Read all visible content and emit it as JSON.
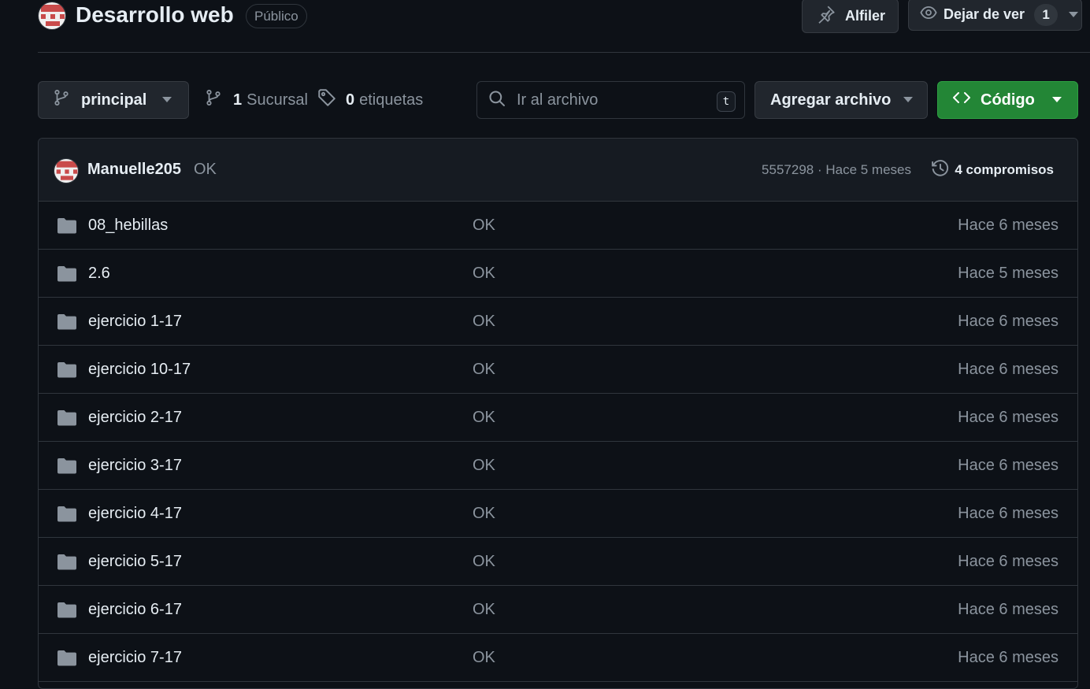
{
  "repo": {
    "title": "Desarrollo web",
    "visibility": "Público",
    "pin_label": "Alfiler",
    "watch_label": "Dejar de ver",
    "watch_count": "1"
  },
  "toolbar": {
    "branch": "principal",
    "branch_count": "1",
    "branch_label": "Sucursal",
    "tag_count": "0",
    "tag_label": "etiquetas",
    "search_placeholder": "Ir al archivo",
    "search_shortcut": "t",
    "add_file_label": "Agregar archivo",
    "code_label": "Código"
  },
  "latest_commit": {
    "author": "Manuelle205",
    "message": "OK",
    "meta": "5557298 · Hace 5 meses",
    "commits_label": "4 compromisos"
  },
  "files": [
    {
      "name": "08_hebillas",
      "commit": "OK",
      "age": "Hace 6 meses"
    },
    {
      "name": "2.6",
      "commit": "OK",
      "age": "Hace 5 meses"
    },
    {
      "name": "ejercicio 1-17",
      "commit": "OK",
      "age": "Hace 6 meses"
    },
    {
      "name": "ejercicio 10-17",
      "commit": "OK",
      "age": "Hace 6 meses"
    },
    {
      "name": "ejercicio 2-17",
      "commit": "OK",
      "age": "Hace 6 meses"
    },
    {
      "name": "ejercicio 3-17",
      "commit": "OK",
      "age": "Hace 6 meses"
    },
    {
      "name": "ejercicio 4-17",
      "commit": "OK",
      "age": "Hace 6 meses"
    },
    {
      "name": "ejercicio 5-17",
      "commit": "OK",
      "age": "Hace 6 meses"
    },
    {
      "name": "ejercicio 6-17",
      "commit": "OK",
      "age": "Hace 6 meses"
    },
    {
      "name": "ejercicio 7-17",
      "commit": "OK",
      "age": "Hace 6 meses"
    }
  ],
  "colors": {
    "background": "#0d1117",
    "surface": "#161b22",
    "border": "#30363d",
    "accent_green": "#238636",
    "avatar_red": "#c94b4b"
  },
  "icons": [
    "identicon",
    "pin-icon",
    "eye-icon",
    "chevron-down-icon",
    "branch-icon",
    "tag-icon",
    "search-icon",
    "code-icon",
    "history-icon",
    "folder-icon"
  ]
}
